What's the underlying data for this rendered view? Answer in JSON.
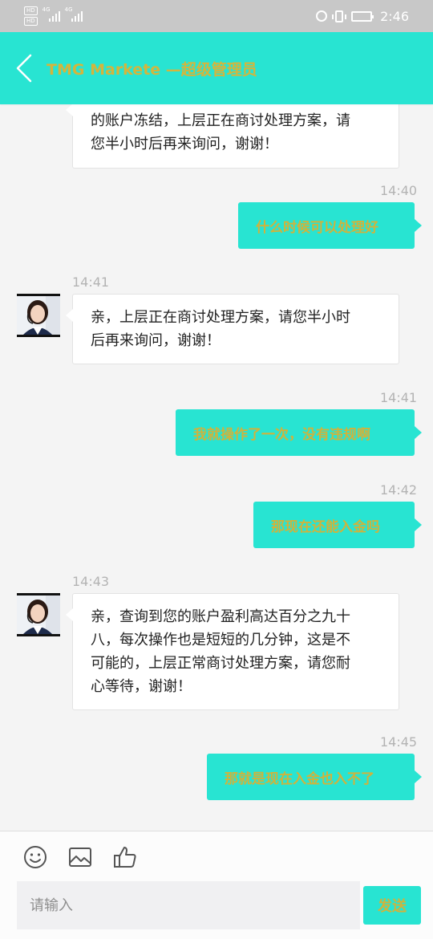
{
  "status_bar": {
    "hd1": "HD",
    "hd2": "HD",
    "net1": "4G",
    "net2": "4G",
    "time": "2:46"
  },
  "header": {
    "title": "TMG Markete —超级管理员",
    "title_color": "#d4b53c",
    "background": "#28e4d2"
  },
  "messages": [
    {
      "direction": "in",
      "time": "",
      "lines": [
        "的账户冻结，上层正在商讨处理方案，请",
        "您半小时后再来询问，谢谢！"
      ]
    },
    {
      "direction": "out",
      "time": "14:40",
      "text": "什么时候可以处理好"
    },
    {
      "direction": "in",
      "time": "14:41",
      "lines": [
        "亲，上层正在商讨处理方案，请您半小时",
        "后再来询问，谢谢！"
      ]
    },
    {
      "direction": "out",
      "time": "14:41",
      "text": "我就操作了一次，没有违规啊"
    },
    {
      "direction": "out",
      "time": "14:42",
      "text": "那现在还能入金吗"
    },
    {
      "direction": "in",
      "time": "14:43",
      "lines": [
        "亲，查询到您的账户盈利高达百分之九十",
        "八，每次操作也是短短的几分钟，这是不",
        "可能的，上层正常商讨处理方案，请您耐",
        "心等待，谢谢！"
      ]
    },
    {
      "direction": "out",
      "time": "14:45",
      "text": "那就是现在入金也入不了"
    }
  ],
  "toolbar": {
    "icons": [
      "emoji-icon",
      "image-icon",
      "thumbs-up-icon"
    ],
    "input_placeholder": "请输入",
    "input_value": "",
    "send_label": "发送"
  }
}
